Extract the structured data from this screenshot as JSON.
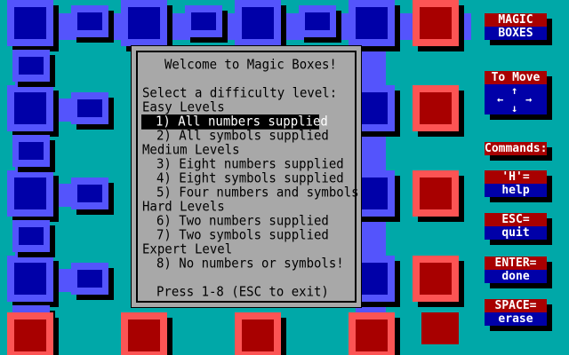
{
  "board": {
    "blue": "#0000a8",
    "light_blue": "#5454fc",
    "red": "#a80000",
    "pink": "#fc5454",
    "shadow": "#000000",
    "background": "#00a8a8"
  },
  "dialog": {
    "title": "Welcome to Magic Boxes!",
    "prompt": "Select a difficulty level:",
    "groups": [
      {
        "label": "Easy Levels",
        "options": [
          "1) All numbers supplied",
          "2) All symbols supplied"
        ]
      },
      {
        "label": "Medium Levels",
        "options": [
          "3) Eight numbers supplied",
          "4) Eight symbols supplied",
          "5) Four numbers and symbols"
        ]
      },
      {
        "label": "Hard Levels",
        "options": [
          "6) Two numbers supplied",
          "7) Two symbols supplied"
        ]
      },
      {
        "label": "Expert Level",
        "options": [
          "8) No numbers or symbols!"
        ]
      }
    ],
    "selected": "1) All numbers supplied",
    "footer": "Press 1-8 (ESC to exit)"
  },
  "sidebar": {
    "title_line1": "MAGIC",
    "title_line2": "BOXES",
    "move_label": "To Move",
    "arrow_up": "↑",
    "arrow_down": "↓",
    "arrow_left": "←",
    "arrow_right": "→",
    "commands_label": "Commands:",
    "help_key": "'H'=",
    "help_action": "help",
    "quit_key": "ESC=",
    "quit_action": "quit",
    "done_key": "ENTER=",
    "done_action": "done",
    "erase_key": "SPACE=",
    "erase_action": "erase"
  }
}
